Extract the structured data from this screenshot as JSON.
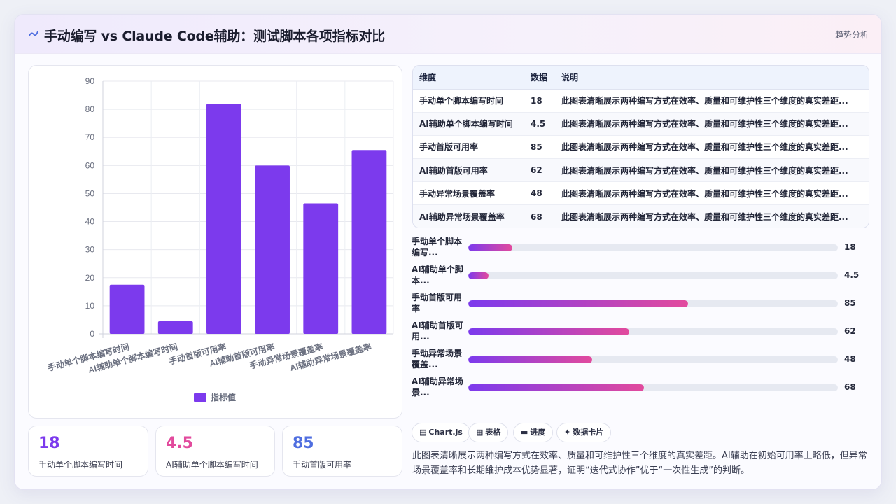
{
  "header": {
    "title": "手动编写 vs Claude Code辅助：测试脚本各项指标对比",
    "tag": "趋势分析",
    "icon": "wave-icon"
  },
  "colors": {
    "accent": "#7c3aed",
    "pink": "#e24a9d",
    "blue": "#4f6ee0",
    "bar": "#7c3aed"
  },
  "chart_data": {
    "type": "bar",
    "categories": [
      "手动单个脚本编写时间",
      "AI辅助单个脚本编写时间",
      "手动首版可用率",
      "AI辅助首版可用率",
      "手动异常场景覆盖率",
      "AI辅助异常场景覆盖率"
    ],
    "series": [
      {
        "name": "指标值",
        "values": [
          17.5,
          4.5,
          82,
          60,
          46.5,
          65.5
        ]
      }
    ],
    "ylim": [
      0,
      90
    ],
    "yticks": [
      0,
      10,
      20,
      30,
      40,
      50,
      60,
      70,
      80,
      90
    ],
    "grid": true,
    "legend": "bottom"
  },
  "kpis": [
    {
      "value": "18",
      "label": "手动单个脚本编写时间"
    },
    {
      "value": "4.5",
      "label": "AI辅助单个脚本编写时间"
    },
    {
      "value": "85",
      "label": "手动首版可用率"
    }
  ],
  "table": {
    "headers": [
      "维度",
      "数据",
      "说明"
    ],
    "rows": [
      {
        "dim": "手动单个脚本编写时间",
        "val": "18",
        "desc": "此图表清晰展示两种编写方式在效率、质量和可维护性三个维度的真实差距..."
      },
      {
        "dim": "AI辅助单个脚本编写时间",
        "val": "4.5",
        "desc": "此图表清晰展示两种编写方式在效率、质量和可维护性三个维度的真实差距..."
      },
      {
        "dim": "手动首版可用率",
        "val": "85",
        "desc": "此图表清晰展示两种编写方式在效率、质量和可维护性三个维度的真实差距..."
      },
      {
        "dim": "AI辅助首版可用率",
        "val": "62",
        "desc": "此图表清晰展示两种编写方式在效率、质量和可维护性三个维度的真实差距..."
      },
      {
        "dim": "手动异常场景覆盖率",
        "val": "48",
        "desc": "此图表清晰展示两种编写方式在效率、质量和可维护性三个维度的真实差距..."
      },
      {
        "dim": "AI辅助异常场景覆盖率",
        "val": "68",
        "desc": "此图表清晰展示两种编写方式在效率、质量和可维护性三个维度的真实差距..."
      }
    ]
  },
  "progress": [
    {
      "label": "手动单个脚本编写...",
      "value": "18",
      "fraction": 0.12
    },
    {
      "label": "AI辅助单个脚本...",
      "value": "4.5",
      "fraction": 0.055
    },
    {
      "label": "手动首版可用率",
      "value": "85",
      "fraction": 0.595
    },
    {
      "label": "AI辅助首版可用...",
      "value": "62",
      "fraction": 0.435
    },
    {
      "label": "手动异常场景覆盖...",
      "value": "48",
      "fraction": 0.335
    },
    {
      "label": "AI辅助异常场景...",
      "value": "68",
      "fraction": 0.475
    }
  ],
  "chips": [
    {
      "icon": "chart-icon",
      "glyph": "▤",
      "label": "Chart.js"
    },
    {
      "icon": "table-icon",
      "glyph": "▦",
      "label": "表格"
    },
    {
      "icon": "progress-icon",
      "glyph": "▬",
      "label": "进度"
    },
    {
      "icon": "card-icon",
      "glyph": "✦",
      "label": "数据卡片"
    }
  ],
  "summary": "此图表清晰展示两种编写方式在效率、质量和可维护性三个维度的真实差距。AI辅助在初始可用率上略低，但异常场景覆盖率和长期维护成本优势显著，证明“迭代式协作”优于“一次性生成”的判断。"
}
